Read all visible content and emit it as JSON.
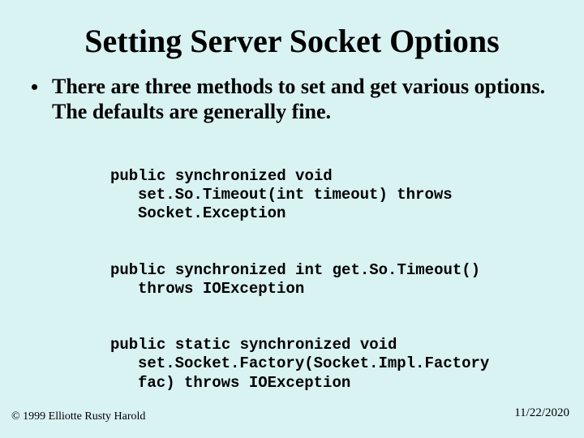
{
  "title": "Setting Server Socket Options",
  "bullet": {
    "marker": "•",
    "text": "There are three methods to set and get various options. The defaults are generally fine."
  },
  "code": {
    "line1": "public synchronized void set.So.Timeout(int timeout) throws Socket.Exception",
    "line2": "public synchronized int get.So.Timeout() throws IOException",
    "line3": "public static synchronized void set.Socket.Factory(Socket.Impl.Factory fac) throws IOException"
  },
  "footer": {
    "copyright": "© 1999 Elliotte Rusty Harold",
    "date": "11/22/2020"
  }
}
